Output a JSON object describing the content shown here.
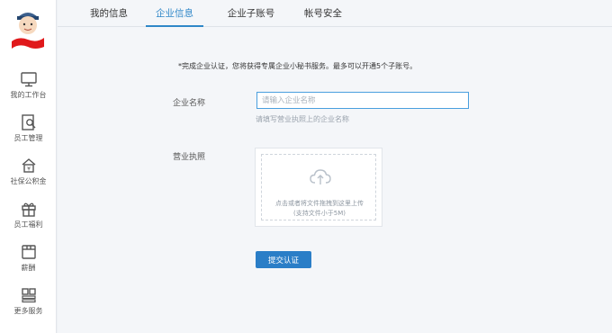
{
  "sidebar": {
    "avatar_label": "avatar",
    "items": [
      {
        "label": "我的工作台",
        "icon": "monitor-icon"
      },
      {
        "label": "员工管理",
        "icon": "employee-manage-icon"
      },
      {
        "label": "社保公积金",
        "icon": "house-fund-icon"
      },
      {
        "label": "员工福利",
        "icon": "gift-icon"
      },
      {
        "label": "薪酬",
        "icon": "salary-icon"
      },
      {
        "label": "更多服务",
        "icon": "more-services-icon"
      }
    ]
  },
  "tabs": [
    {
      "label": "我的信息",
      "active": false
    },
    {
      "label": "企业信息",
      "active": true
    },
    {
      "label": "企业子账号",
      "active": false
    },
    {
      "label": "帐号安全",
      "active": false
    }
  ],
  "form": {
    "notice": "*完成企业认证，您将获得专属企业小秘书服务。最多可以开通5个子账号。",
    "company_name_label": "企业名称",
    "company_name_placeholder": "请输入企业名称",
    "company_name_value": "",
    "company_name_hint": "请填写营业执照上的企业名称",
    "license_label": "营业执照",
    "upload_text": "点击或者将文件拖拽到这里上传",
    "upload_limit": "(支持文件小于5M)",
    "submit_label": "提交认证"
  },
  "colors": {
    "accent": "#2f87c8",
    "button": "#2a7ec7",
    "avatar_ribbon": "#e0191b"
  }
}
